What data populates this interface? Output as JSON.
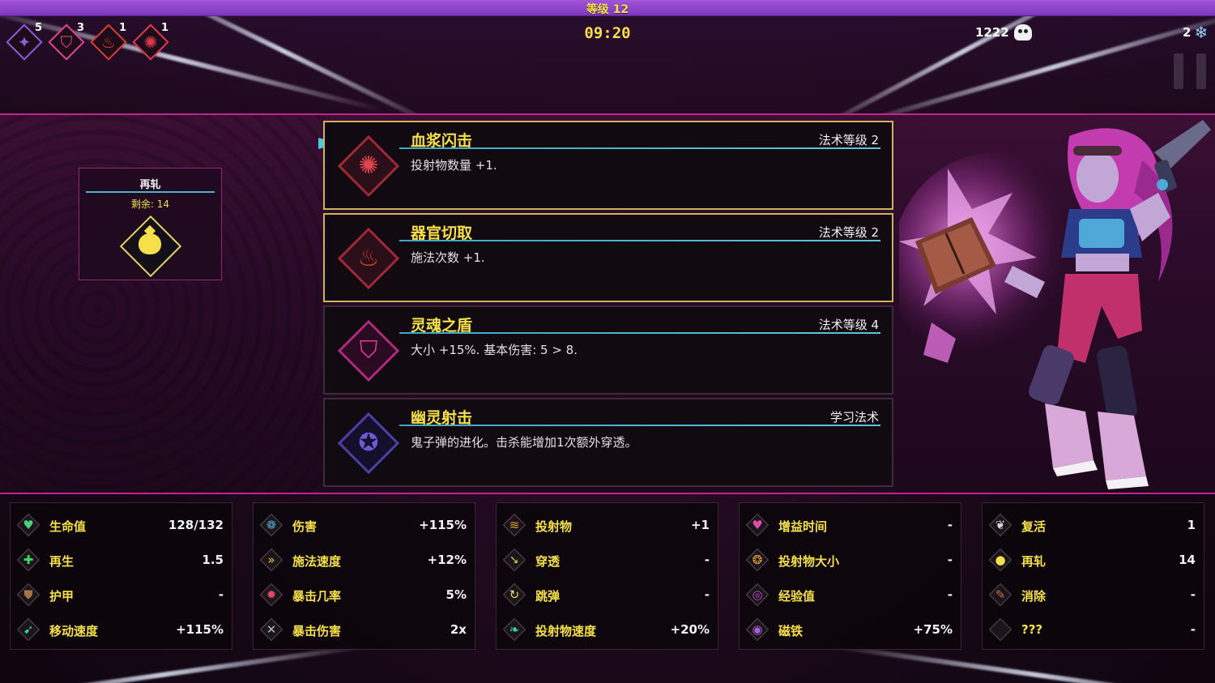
{
  "header": {
    "level_label": "等级 12",
    "timer": "09:20",
    "kill_count": "1222",
    "gem_count": "2"
  },
  "buffs": [
    {
      "icon": "purple-star-icon",
      "count": "5",
      "color": "#8e5cd6"
    },
    {
      "icon": "pink-shield-icon",
      "count": "3",
      "color": "#e0448a"
    },
    {
      "icon": "red-organ-icon",
      "count": "1",
      "color": "#d6402e"
    },
    {
      "icon": "red-burst-icon",
      "count": "1",
      "color": "#e03a4a"
    }
  ],
  "reroll_panel": {
    "title": "再轧",
    "remaining": "剩余: 14",
    "icon": "yellow-bag-icon"
  },
  "spell_cards": [
    {
      "name": "血浆闪击",
      "level": "法术等级 2",
      "desc": "投射物数量 +1.",
      "icon": "blood-burst-icon",
      "selected": true,
      "color": "#e0444f"
    },
    {
      "name": "器官切取",
      "level": "法术等级 2",
      "desc": "施法次数 +1.",
      "icon": "organ-icon",
      "selected": true,
      "color": "#d4402c"
    },
    {
      "name": "灵魂之盾",
      "level": "法术等级 4",
      "desc": "大小 +15%. 基本伤害: 5 > 8.",
      "icon": "soul-shield-icon",
      "selected": false,
      "color": "#e53c9b"
    },
    {
      "name": "幽灵射击",
      "level": "学习法术",
      "desc": "鬼子弹的进化。击杀能增加1次额外穿透。",
      "icon": "ghost-star-icon",
      "selected": false,
      "color": "#6a5ad6"
    }
  ],
  "stats": [
    [
      {
        "label": "生命值",
        "value": "128/132",
        "icon": "heart-icon"
      },
      {
        "label": "再生",
        "value": "1.5",
        "icon": "plus-icon"
      },
      {
        "label": "护甲",
        "value": "-",
        "icon": "armor-icon"
      },
      {
        "label": "移动速度",
        "value": "+115%",
        "icon": "boot-icon"
      }
    ],
    [
      {
        "label": "伤害",
        "value": "+115%",
        "icon": "brain-icon"
      },
      {
        "label": "施法速度",
        "value": "+12%",
        "icon": "fast-forward-icon"
      },
      {
        "label": "暴击几率",
        "value": "5%",
        "icon": "crit-icon"
      },
      {
        "label": "暴击伤害",
        "value": "2x",
        "icon": "crit-damage-icon"
      }
    ],
    [
      {
        "label": "投射物",
        "value": "+1",
        "icon": "projectile-icon"
      },
      {
        "label": "穿透",
        "value": "-",
        "icon": "pierce-icon"
      },
      {
        "label": "跳弹",
        "value": "-",
        "icon": "bounce-icon"
      },
      {
        "label": "投射物速度",
        "value": "+20%",
        "icon": "wing-icon"
      }
    ],
    [
      {
        "label": "增益时间",
        "value": "-",
        "icon": "buff-heart-icon"
      },
      {
        "label": "投射物大小",
        "value": "-",
        "icon": "size-icon"
      },
      {
        "label": "经验值",
        "value": "-",
        "icon": "xp-icon"
      },
      {
        "label": "磁铁",
        "value": "+75%",
        "icon": "magnet-icon"
      }
    ],
    [
      {
        "label": "复活",
        "value": "1",
        "icon": "revive-icon"
      },
      {
        "label": "再轧",
        "value": "14",
        "icon": "reroll-bag-icon"
      },
      {
        "label": "消除",
        "value": "-",
        "icon": "banish-icon"
      },
      {
        "label": "???",
        "value": "-",
        "icon": "unknown-icon"
      }
    ]
  ],
  "colors": {
    "accent_yellow": "#f5e04a",
    "level_bar": "#8e44c8",
    "border_magenta": "#c0248f",
    "line_cyan": "#3fa6c4"
  }
}
